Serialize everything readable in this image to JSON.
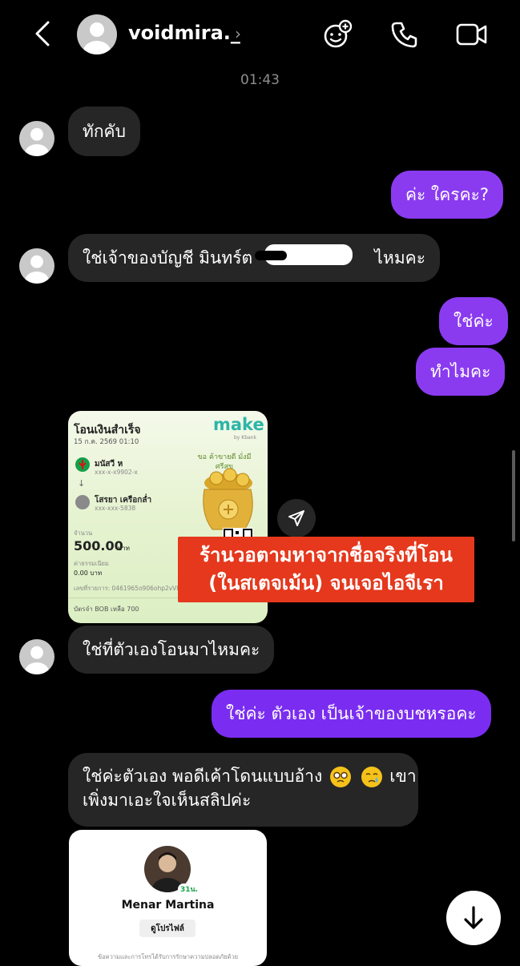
{
  "header": {
    "username": "voidmira._",
    "chevron": "›"
  },
  "timestamp": "01:43",
  "messages": [
    {
      "text": "ทักคับ"
    },
    {
      "text": "ค่ะ ใครคะ?"
    },
    {
      "text": "ใช่เจ้าของบัญชี มินทร์ต",
      "text_end": "ไหมคะ"
    },
    {
      "text": "ใช่ค่ะ"
    },
    {
      "text": "ทำไมคะ"
    },
    {
      "text": "ใช่ที่ตัวเองโอนมาไหมคะ"
    },
    {
      "text": "ใช่ค่ะ ตัวเอง เป็นเจ้าของบชหรอคะ"
    },
    {
      "line1": "ใช่ค่ะตัวเอง พอดีเค้าโดนแบบอ้าง",
      "line1_end": "เขา",
      "line2": "เพิ่งมาเอะใจเห็นสลิปค่ะ"
    }
  ],
  "slip": {
    "title": "โอนเงินสำเร็จ",
    "datetime": "15 ก.ค. 2569 01:10",
    "brand": "make",
    "brand_sub": "by Kbank",
    "banner": "ขอ ค้าขายดี มั่งมี ศรีสุข",
    "sender_name": "มนัสวี ห",
    "sender_acct": "xxx-x-x9902-x",
    "receiver_name": "โสรยา เครือกล่ำ",
    "receiver_acct": "xxx-xxx-5838",
    "amount_label": "จำนวน",
    "amount": "500.00",
    "amount_unit": "บาท",
    "fee_label": "ค่าธรรมเนียม",
    "fee": "0.00 บาท",
    "ref": "เลขที่รายการ: 0461965o906ohp2vVkZS",
    "footer": "บัตรจำ BOB เหลือ 700"
  },
  "caption": {
    "line1": "ร้านวอตามหาจากชื่อจริงที่โอน",
    "line2": "(ในสเตจเม้น) จนเจอไอจีเรา"
  },
  "profile_card": {
    "badge": "31น.",
    "name": "Menar Martina",
    "button": "ดูโปรไฟล์",
    "note": "ข้อความและการโทรได้รับการรักษาความปลอดภัยด้วย"
  },
  "colors": {
    "outgoing": "#8a3bf0",
    "incoming": "#262626",
    "caption_bg": "#e5381d"
  }
}
